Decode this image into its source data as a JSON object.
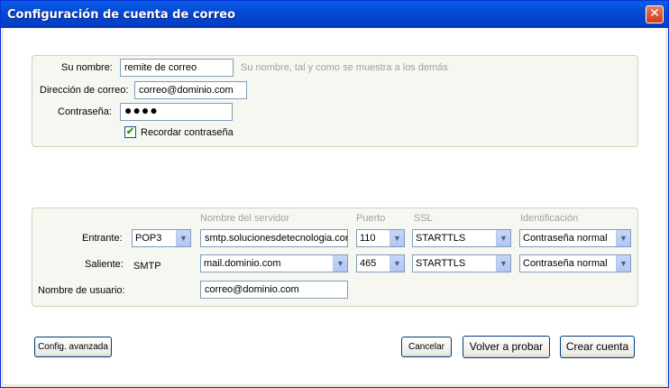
{
  "window": {
    "title": "Configuración de cuenta de correo",
    "close_glyph": "✕"
  },
  "identity": {
    "name_label": "Su nombre:",
    "name_value": "remite de correo",
    "name_hint": "Su nombre, tal y como se muestra a los demás",
    "email_label": "Dirección de correo:",
    "email_value": "correo@dominio.com",
    "password_label": "Contraseña:",
    "password_value": "●●●●",
    "remember_label": "Recordar contraseña",
    "remember_checked": true
  },
  "server": {
    "headers": {
      "server_name": "Nombre del servidor",
      "port": "Puerto",
      "ssl": "SSL",
      "auth": "Identificación"
    },
    "incoming": {
      "label": "Entrante:",
      "protocol": "POP3",
      "server": "smtp.solucionesdetecnologia.com",
      "port": "110",
      "ssl": "STARTTLS",
      "auth": "Contraseña normal"
    },
    "outgoing": {
      "label": "Saliente:",
      "protocol": "SMTP",
      "server": "mail.dominio.com",
      "port": "465",
      "ssl": "STARTTLS",
      "auth": "Contraseña normal"
    },
    "username_label": "Nombre de usuario:",
    "username_value": "correo@dominio.com"
  },
  "buttons": {
    "advanced": "Config. avanzada",
    "cancel": "Cancelar",
    "retry": "Volver a probar",
    "create": "Crear cuenta"
  },
  "colors": {
    "titlebar": "#0449d6",
    "close": "#cf3a1c",
    "check": "#21a121"
  }
}
